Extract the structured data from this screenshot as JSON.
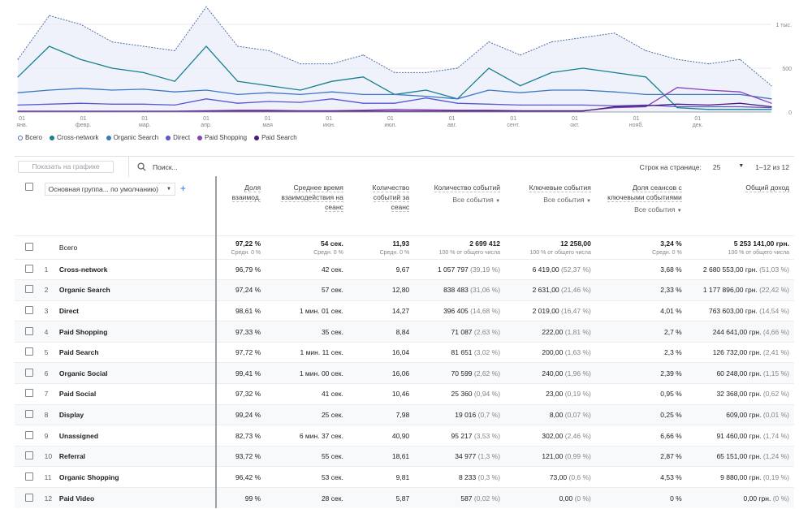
{
  "chart_data": {
    "type": "line",
    "x": [
      "01.01",
      "15.01",
      "01.02",
      "15.02",
      "01.03",
      "15.03",
      "01.04",
      "15.04",
      "01.05",
      "15.05",
      "01.06",
      "15.06",
      "01.07",
      "15.07",
      "01.08",
      "15.08",
      "01.09",
      "15.09",
      "01.10",
      "15.10",
      "01.11",
      "15.11",
      "01.12",
      "15.12",
      "31.12"
    ],
    "x_ticks": [
      {
        "day": "01",
        "month": "янв."
      },
      {
        "day": "01",
        "month": "февр."
      },
      {
        "day": "01",
        "month": "мар."
      },
      {
        "day": "01",
        "month": "апр."
      },
      {
        "day": "01",
        "month": "мая"
      },
      {
        "day": "01",
        "month": "июн."
      },
      {
        "day": "01",
        "month": "июл."
      },
      {
        "day": "01",
        "month": "авг."
      },
      {
        "day": "01",
        "month": "сент."
      },
      {
        "day": "01",
        "month": "окт."
      },
      {
        "day": "01",
        "month": "нояб."
      },
      {
        "day": "01",
        "month": "дек."
      }
    ],
    "y_ticks": [
      "0",
      "500",
      "1 тыс."
    ],
    "ylim": [
      0,
      1250
    ],
    "grid": true,
    "legend_placement": "bottom-left",
    "series": [
      {
        "name": "Всего",
        "color": "#4f6fa8",
        "style": "dotted-area",
        "values": [
          600,
          1100,
          1000,
          800,
          750,
          700,
          1200,
          750,
          700,
          550,
          550,
          650,
          450,
          450,
          500,
          800,
          650,
          800,
          850,
          900,
          700,
          600,
          550,
          600,
          300
        ]
      },
      {
        "name": "Cross-network",
        "color": "#17808e",
        "values": [
          400,
          750,
          600,
          500,
          450,
          350,
          750,
          350,
          300,
          250,
          350,
          400,
          200,
          250,
          150,
          500,
          300,
          450,
          500,
          450,
          400,
          50,
          30,
          30,
          30
        ]
      },
      {
        "name": "Organic Search",
        "color": "#3a78c6",
        "values": [
          220,
          250,
          270,
          250,
          260,
          230,
          250,
          200,
          220,
          200,
          230,
          200,
          200,
          180,
          150,
          250,
          220,
          250,
          250,
          230,
          200,
          200,
          200,
          200,
          150
        ]
      },
      {
        "name": "Direct",
        "color": "#5a55d0",
        "values": [
          80,
          90,
          100,
          90,
          90,
          80,
          150,
          100,
          120,
          110,
          150,
          100,
          100,
          160,
          100,
          90,
          80,
          80,
          80,
          70,
          80,
          60,
          60,
          60,
          50
        ]
      },
      {
        "name": "Paid Shopping",
        "color": "#8a3fbf",
        "values": [
          10,
          10,
          10,
          10,
          10,
          10,
          15,
          20,
          20,
          15,
          15,
          20,
          30,
          25,
          20,
          20,
          15,
          15,
          15,
          50,
          60,
          280,
          250,
          230,
          100
        ]
      },
      {
        "name": "Paid Search",
        "color": "#4b1a78",
        "values": [
          5,
          5,
          5,
          5,
          5,
          5,
          8,
          8,
          8,
          8,
          8,
          10,
          10,
          10,
          10,
          10,
          10,
          10,
          10,
          60,
          70,
          90,
          80,
          100,
          60
        ]
      }
    ]
  },
  "toolbar": {
    "show_on_chart": "Показать на графике",
    "search_placeholder": "Поиск...",
    "rows_label": "Строк на странице:",
    "rows_value": "25",
    "range": "1–12 из 12"
  },
  "table": {
    "dimension": "Основная группа... по умолчанию)",
    "headers": [
      {
        "title": "Доля взаимод.",
        "sel": ""
      },
      {
        "title": "Среднее время взаимодействия на сеанс",
        "sel": ""
      },
      {
        "title": "Количество событий за сеанс",
        "sel": ""
      },
      {
        "title": "Количество событий",
        "sel": "Все события"
      },
      {
        "title": "Ключевые события",
        "sel": "Все события"
      },
      {
        "title": "Доля сеансов с ключевыми событиями",
        "sel": "Все события"
      },
      {
        "title": "Общий доход",
        "sel": ""
      }
    ],
    "total": {
      "label": "Всего",
      "values": [
        "97,22 %",
        "54 сек.",
        "11,93",
        "2 699 412",
        "12 258,00",
        "3,24 %",
        "5 253 141,00 грн."
      ],
      "subs": [
        "Средн. 0 %",
        "Средн. 0 %",
        "Средн. 0 %",
        "100 % от общего числа",
        "100 % от общего числа",
        "Средн. 0 %",
        "100 % от общего числа"
      ]
    },
    "rows": [
      {
        "idx": "1",
        "name": "Cross-network",
        "eng": "96,79 %",
        "time": "42 сек.",
        "eps": "9,67",
        "ev": "1 057 797",
        "evp": "(39,19 %)",
        "key": "6 419,00",
        "keyp": "(52,37 %)",
        "rate": "3,68 %",
        "rev": "2 680 553,00 грн.",
        "revp": "(51,03 %)"
      },
      {
        "idx": "2",
        "name": "Organic Search",
        "eng": "97,24 %",
        "time": "57 сек.",
        "eps": "12,80",
        "ev": "838 483",
        "evp": "(31,06 %)",
        "key": "2 631,00",
        "keyp": "(21,46 %)",
        "rate": "2,33 %",
        "rev": "1 177 896,00 грн.",
        "revp": "(22,42 %)"
      },
      {
        "idx": "3",
        "name": "Direct",
        "eng": "98,61 %",
        "time": "1 мин. 01 сек.",
        "eps": "14,27",
        "ev": "396 405",
        "evp": "(14,68 %)",
        "key": "2 019,00",
        "keyp": "(16,47 %)",
        "rate": "4,01 %",
        "rev": "763 603,00 грн.",
        "revp": "(14,54 %)"
      },
      {
        "idx": "4",
        "name": "Paid Shopping",
        "eng": "97,33 %",
        "time": "35 сек.",
        "eps": "8,84",
        "ev": "71 087",
        "evp": "(2,63 %)",
        "key": "222,00",
        "keyp": "(1,81 %)",
        "rate": "2,7 %",
        "rev": "244 641,00 грн.",
        "revp": "(4,66 %)"
      },
      {
        "idx": "5",
        "name": "Paid Search",
        "eng": "97,72 %",
        "time": "1 мин. 11 сек.",
        "eps": "16,04",
        "ev": "81 651",
        "evp": "(3,02 %)",
        "key": "200,00",
        "keyp": "(1,63 %)",
        "rate": "2,3 %",
        "rev": "126 732,00 грн.",
        "revp": "(2,41 %)"
      },
      {
        "idx": "6",
        "name": "Organic Social",
        "eng": "99,41 %",
        "time": "1 мин. 00 сек.",
        "eps": "16,06",
        "ev": "70 599",
        "evp": "(2,62 %)",
        "key": "240,00",
        "keyp": "(1,96 %)",
        "rate": "2,39 %",
        "rev": "60 248,00 грн.",
        "revp": "(1,15 %)"
      },
      {
        "idx": "7",
        "name": "Paid Social",
        "eng": "97,32 %",
        "time": "41 сек.",
        "eps": "10,46",
        "ev": "25 360",
        "evp": "(0,94 %)",
        "key": "23,00",
        "keyp": "(0,19 %)",
        "rate": "0,95 %",
        "rev": "32 368,00 грн.",
        "revp": "(0,62 %)"
      },
      {
        "idx": "8",
        "name": "Display",
        "eng": "99,24 %",
        "time": "25 сек.",
        "eps": "7,98",
        "ev": "19 016",
        "evp": "(0,7 %)",
        "key": "8,00",
        "keyp": "(0,07 %)",
        "rate": "0,25 %",
        "rev": "609,00 грн.",
        "revp": "(0,01 %)"
      },
      {
        "idx": "9",
        "name": "Unassigned",
        "eng": "82,73 %",
        "time": "6 мин. 37 сек.",
        "eps": "40,90",
        "ev": "95 217",
        "evp": "(3,53 %)",
        "key": "302,00",
        "keyp": "(2,46 %)",
        "rate": "6,66 %",
        "rev": "91 460,00 грн.",
        "revp": "(1,74 %)"
      },
      {
        "idx": "10",
        "name": "Referral",
        "eng": "93,72 %",
        "time": "55 сек.",
        "eps": "18,61",
        "ev": "34 977",
        "evp": "(1,3 %)",
        "key": "121,00",
        "keyp": "(0,99 %)",
        "rate": "2,87 %",
        "rev": "65 151,00 грн.",
        "revp": "(1,24 %)"
      },
      {
        "idx": "11",
        "name": "Organic Shopping",
        "eng": "96,42 %",
        "time": "53 сек.",
        "eps": "9,81",
        "ev": "8 233",
        "evp": "(0,3 %)",
        "key": "73,00",
        "keyp": "(0,6 %)",
        "rate": "4,53 %",
        "rev": "9 880,00 грн.",
        "revp": "(0,19 %)"
      },
      {
        "idx": "12",
        "name": "Paid Video",
        "eng": "99 %",
        "time": "28 сек.",
        "eps": "5,87",
        "ev": "587",
        "evp": "(0,02 %)",
        "key": "0,00",
        "keyp": "(0 %)",
        "rate": "0 %",
        "rev": "0,00 грн.",
        "revp": "(0 %)"
      }
    ]
  }
}
